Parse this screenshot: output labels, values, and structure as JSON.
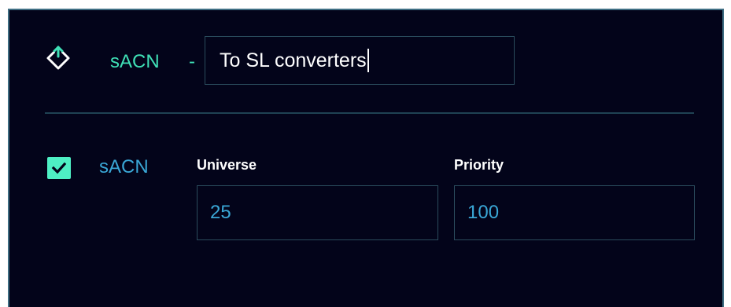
{
  "header": {
    "icon": "diamond-arrow-icon",
    "protocol": "sACN",
    "separator": "-",
    "name_value": "To SL converters"
  },
  "section": {
    "enabled": true,
    "label": "sACN",
    "fields": [
      {
        "label": "Universe",
        "value": "25"
      },
      {
        "label": "Priority",
        "value": "100"
      }
    ]
  },
  "colors": {
    "background": "#03041a",
    "accent": "#3fe0b6",
    "checkbox": "#4ef0c4",
    "section_label": "#3aa7d6",
    "border": "#2a4b5c"
  }
}
